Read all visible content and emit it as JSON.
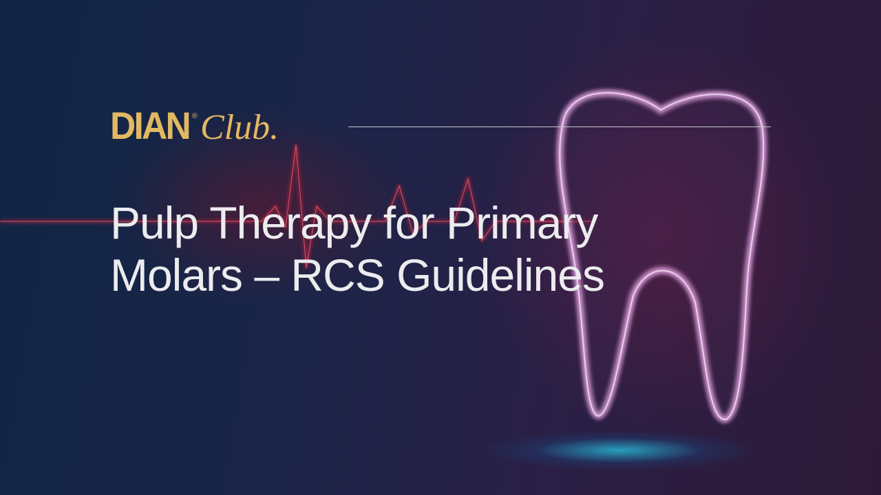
{
  "logo": {
    "brand": "DIAN",
    "registered": "®",
    "club": "Club."
  },
  "title": {
    "line1": "Pulp Therapy for Primary",
    "line2": "Molars – RCS Guidelines"
  },
  "colors": {
    "gold": "#e3b862",
    "title": "#ececef"
  }
}
